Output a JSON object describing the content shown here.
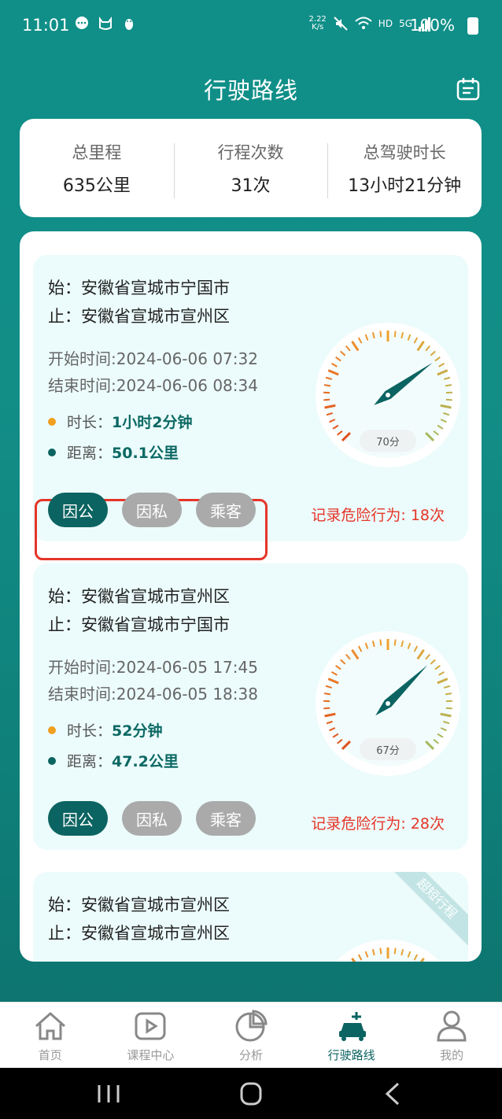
{
  "status": {
    "time": "11:01",
    "net_speed_top": "2.22",
    "net_speed_bottom": "K/s",
    "hd": "HD",
    "signal": "5G",
    "battery": "100%"
  },
  "header": {
    "title": "行驶路线"
  },
  "summary": [
    {
      "label": "总里程",
      "value": "635公里"
    },
    {
      "label": "行程次数",
      "value": "31次"
    },
    {
      "label": "总驾驶时长",
      "value": "13小时21分钟"
    }
  ],
  "trips": [
    {
      "start": "始：安徽省宣城市宁国市",
      "end": "止：安徽省宣城市宣州区",
      "start_time": "开始时间:2024-06-06 07:32",
      "end_time": "结束时间:2024-06-06 08:34",
      "duration_label": "时长：",
      "duration": "1小时2分钟",
      "distance_label": "距离：",
      "distance": "50.1公里",
      "tags": [
        "因公",
        "因私",
        "乘客"
      ],
      "danger": "记录危险行为: 18次",
      "score": "70分",
      "score_value": 70
    },
    {
      "start": "始：安徽省宣城市宣州区",
      "end": "止：安徽省宣城市宁国市",
      "start_time": "开始时间:2024-06-05 17:45",
      "end_time": "结束时间:2024-06-05 18:38",
      "duration_label": "时长：",
      "duration": "52分钟",
      "distance_label": "距离：",
      "distance": "47.2公里",
      "tags": [
        "因公",
        "因私",
        "乘客"
      ],
      "danger": "记录危险行为: 28次",
      "score": "67分",
      "score_value": 67
    },
    {
      "start": "始：安徽省宣城市宣州区",
      "end": "止：安徽省宣城市宣州区",
      "ribbon": "超短行程"
    }
  ],
  "tabs": [
    {
      "label": "首页"
    },
    {
      "label": "课程中心"
    },
    {
      "label": "分析"
    },
    {
      "label": "行驶路线"
    },
    {
      "label": "我的"
    }
  ],
  "colors": {
    "brand": "#0b6461",
    "danger": "#e53528",
    "duration_dot": "#f0a020",
    "distance_dot": "#0b6461"
  }
}
